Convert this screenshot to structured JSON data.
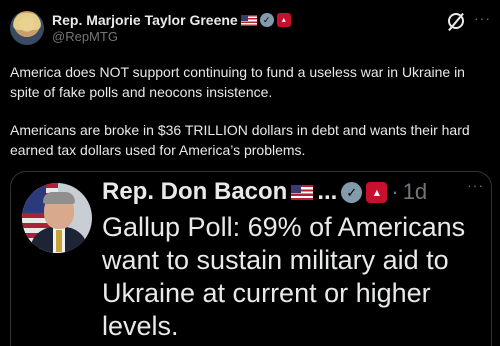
{
  "post": {
    "display_name": "Rep. Marjorie Taylor Greene",
    "handle": "@RepMTG",
    "paragraph_1": "America does NOT support continuing to fund a useless war in Ukraine in spite of fake polls and neocons insistence.",
    "paragraph_2": "Americans are broke in $36 TRILLION dollars in debt and wants their hard earned tax dollars used for America’s problems.",
    "more_label": "···",
    "verified_glyph": "✓",
    "gov_glyph": "▴"
  },
  "quote": {
    "display_name": "Rep. Don Bacon",
    "ellipsis": "...",
    "separator": "·",
    "time": "1d",
    "text": "Gallup Poll: 69% of Americans want to sustain military aid to Ukraine at current or higher levels.",
    "more_label": "···",
    "verified_glyph": "✓",
    "gov_glyph": "▴"
  },
  "colors": {
    "background": "#000000",
    "text": "#e7e9ea",
    "secondary": "#71767b",
    "border": "#2f3336",
    "verified_gray": "#829aab",
    "gov_red": "#c8102e"
  },
  "icons": [
    "avatar",
    "us-flag-icon",
    "verified-badge-icon",
    "government-badge-icon",
    "grok-icon",
    "more-icon"
  ]
}
